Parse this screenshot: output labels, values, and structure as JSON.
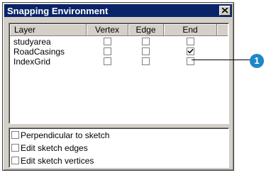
{
  "window": {
    "title": "Snapping Environment"
  },
  "columns": {
    "layer": "Layer",
    "vertex": "Vertex",
    "edge": "Edge",
    "end": "End"
  },
  "layers": [
    {
      "name": "studyarea",
      "vertex": false,
      "edge": false,
      "end": false
    },
    {
      "name": "RoadCasings",
      "vertex": false,
      "edge": false,
      "end": true
    },
    {
      "name": "IndexGrid",
      "vertex": false,
      "edge": false,
      "end": false
    }
  ],
  "options": [
    {
      "label": "Perpendicular to sketch",
      "checked": false
    },
    {
      "label": "Edit sketch edges",
      "checked": false
    },
    {
      "label": "Edit sketch vertices",
      "checked": false
    }
  ],
  "callout": {
    "number": "1",
    "color": "#1f87c7"
  },
  "colors": {
    "titlebar": "#0a246a",
    "face": "#d4d0c8"
  }
}
